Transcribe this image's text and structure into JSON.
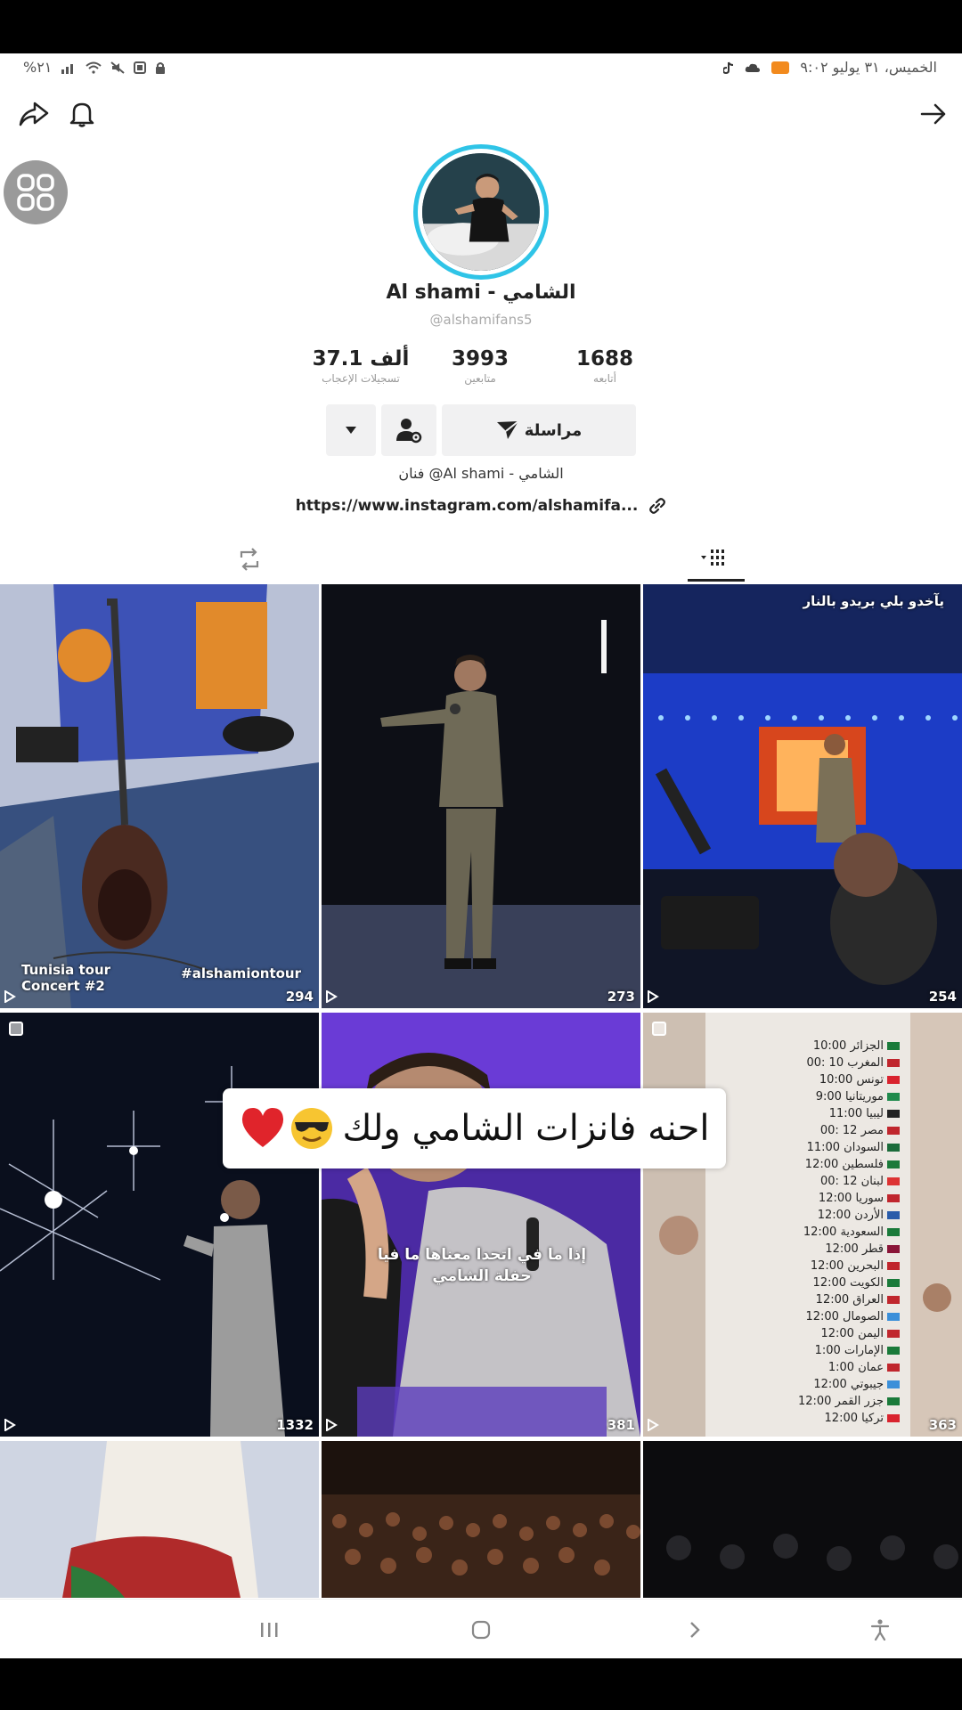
{
  "status_bar": {
    "datetime": "الخميس، ٣١ يوليو  ٩:٠٢",
    "battery": "%٢١"
  },
  "profile": {
    "name": "Al shami - الشامي",
    "handle": "@alshamifans5",
    "stats": [
      {
        "value": "1688",
        "label": "أتابعه"
      },
      {
        "value": "3993",
        "label": "متابعين"
      },
      {
        "value": "37.1 ألف",
        "label": "تسجيلات الإعجاب"
      }
    ],
    "message_button": "مراسلة",
    "bio": "فنان @Al shami - الشامي",
    "link": "https://www.instagram.com/alshamifa..."
  },
  "grid": {
    "tiles": [
      {
        "views": "294",
        "caption": "Tunisia tour Concert #2",
        "caption2": "#alshamiontour"
      },
      {
        "views": "273"
      },
      {
        "views": "254",
        "caption": "يآخدو بلي بريدو بالنار"
      },
      {
        "views": "1332"
      },
      {
        "views": "381",
        "caption": "إذا ما في اتحدا معناها ما فيا حفلة الشامي"
      },
      {
        "views": "363"
      }
    ],
    "country_list": [
      "الجزائر 10:00",
      "المغرب 10 :00",
      "تونس 10:00",
      "موريتانيا 9:00",
      "ليبيا 11:00",
      "مصر 12 :00",
      "السودان 11:00",
      "فلسطين 12:00",
      "لبنان 12 :00",
      "سوريا 12:00",
      "الأردن 12:00",
      "السعودية 12:00",
      "قطر 12:00",
      "البحرين 12:00",
      "الكويت 12:00",
      "العراق 12:00",
      "الصومال 12:00",
      "اليمن 12:00",
      "الإمارات 1:00",
      "عمان 1:00",
      "جيبوتي 12:00",
      "جزر القمر 12:00",
      "تركيا 12:00"
    ]
  },
  "overlay_caption": "احنه فانزات الشامي ولك",
  "colors": {
    "avatar_ring": "#2fc4e7",
    "button_bg": "#f1f1f2",
    "heart": "#e0242b"
  }
}
